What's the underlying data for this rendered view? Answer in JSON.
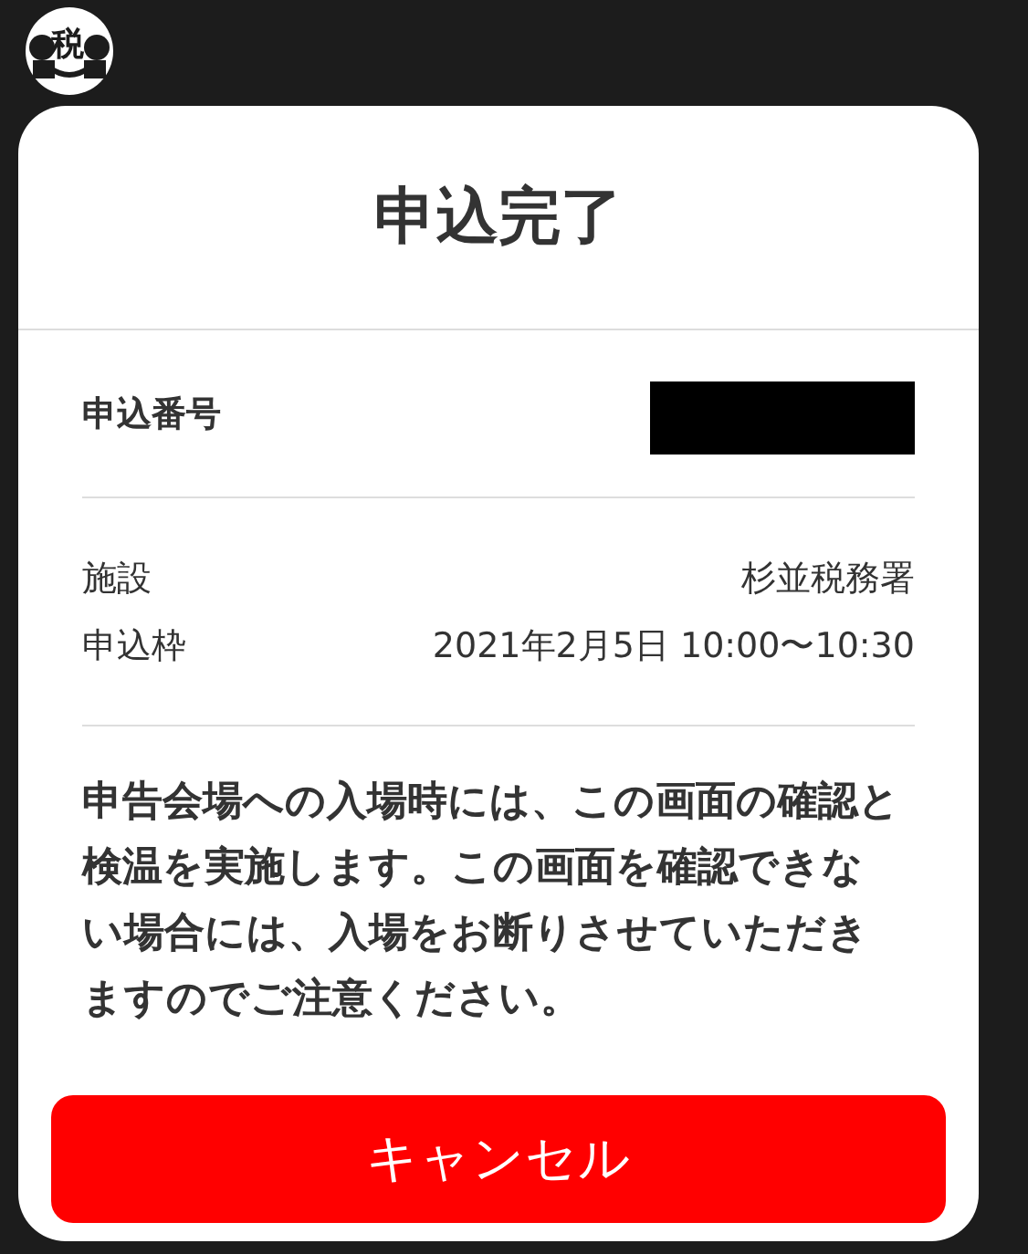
{
  "logo": {
    "text": "税"
  },
  "dialog": {
    "title": "申込完了",
    "application_number": {
      "label": "申込番号",
      "redacted": true
    },
    "details": [
      {
        "label": "施設",
        "value": "杉並税務署"
      },
      {
        "label": "申込枠",
        "value": "2021年2月5日 10:00〜10:30"
      }
    ],
    "notice": "申告会場への入場時には、この画面の確認と検温を実施します。この画面を確認できない場合には、入場をお断りさせていただきますのでご注意ください。",
    "button": "キャンセル"
  }
}
